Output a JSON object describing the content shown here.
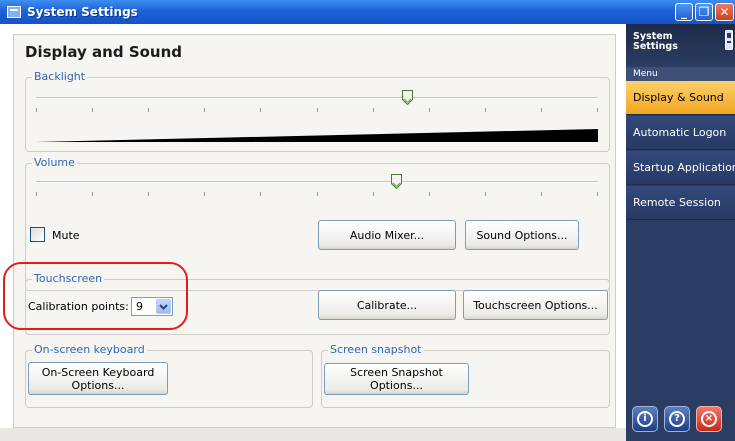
{
  "window": {
    "title": "System Settings",
    "buttons": {
      "minimize": "_",
      "maximize": "❐",
      "close": "✕"
    }
  },
  "page": {
    "title": "Display and Sound"
  },
  "backlight": {
    "label": "Backlight",
    "level_percent": 66
  },
  "volume": {
    "label": "Volume",
    "level_percent": 64
  },
  "sound": {
    "mute_label": "Mute",
    "mute_checked": false,
    "audio_mixer_button": "Audio Mixer...",
    "sound_options_button": "Sound Options..."
  },
  "touchscreen": {
    "label": "Touchscreen",
    "calibration_label": "Calibration points:",
    "calibration_value": "9",
    "calibrate_button": "Calibrate...",
    "options_button": "Touchscreen Options..."
  },
  "keyboard": {
    "label": "On-screen keyboard",
    "button_line1": "On-Screen Keyboard",
    "button_line2": "Options..."
  },
  "snapshot": {
    "label": "Screen snapshot",
    "button": "Screen Snapshot Options..."
  },
  "sidebar": {
    "title_line1": "System",
    "title_line2": "Settings",
    "menu_label": "Menu",
    "items": [
      {
        "label": "Display & Sound",
        "active": true
      },
      {
        "label": "Automatic Logon",
        "active": false
      },
      {
        "label": "Startup Applications",
        "active": false
      },
      {
        "label": "Remote Session",
        "active": false
      }
    ],
    "bottom_buttons": [
      {
        "icon": "info-icon",
        "glyph": "i"
      },
      {
        "icon": "help-icon",
        "glyph": "?"
      },
      {
        "icon": "exit-icon",
        "glyph": "×"
      }
    ]
  },
  "colors": {
    "titlebar": "#1d63d8",
    "group_label": "#3065b5",
    "sidebar_bg": "#2c3d63",
    "sidebar_active": "#f2a621",
    "highlight_ring": "#e31d1d"
  }
}
